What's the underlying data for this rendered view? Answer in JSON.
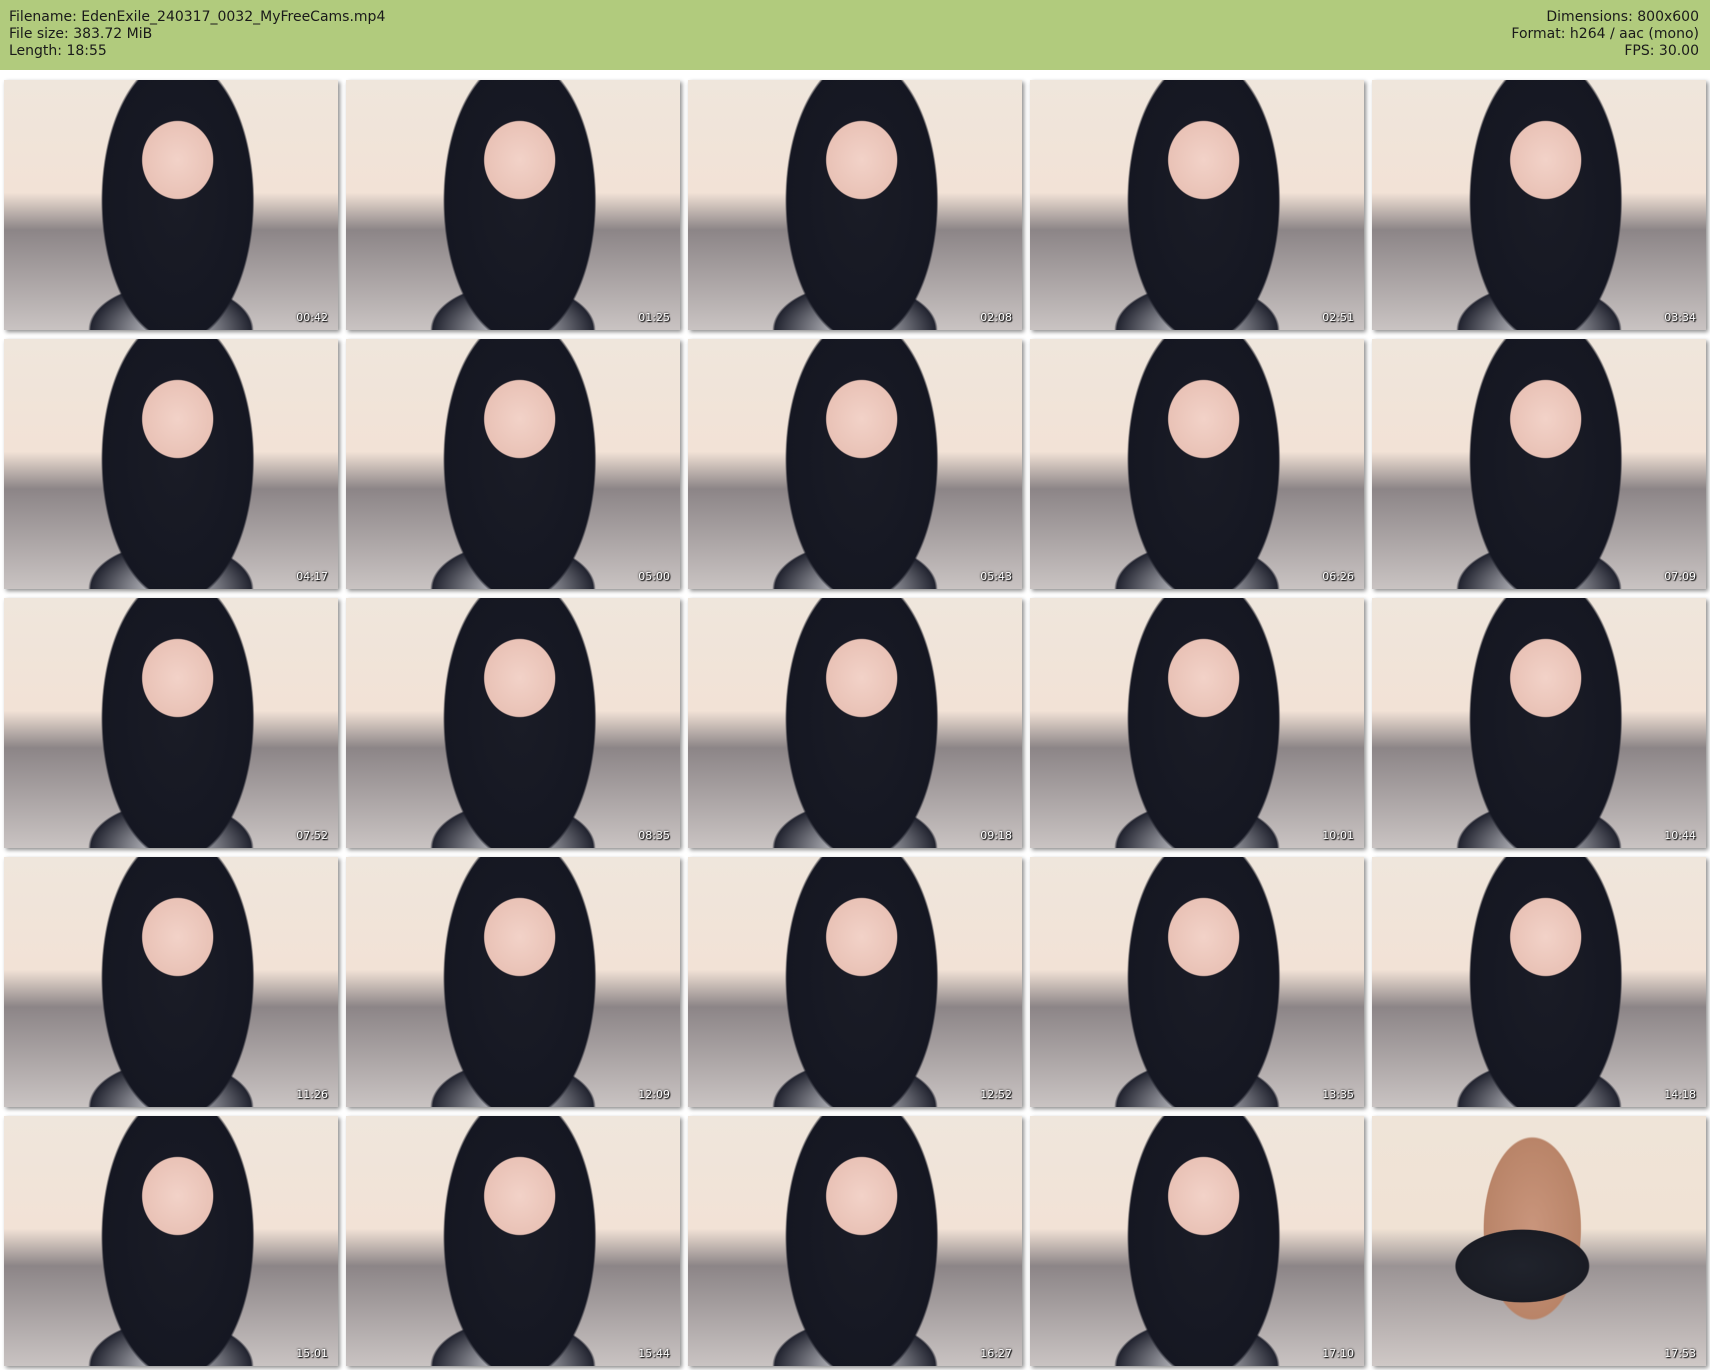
{
  "header": {
    "filename": "Filename: EdenExile_240317_0032_MyFreeCams.mp4",
    "file_size": "File size: 383.72 MiB",
    "length": "Length: 18:55",
    "dimensions": "Dimensions: 800x600",
    "format": "Format: h264 / aac (mono)",
    "fps": "FPS: 30.00"
  },
  "thumbnails": [
    "00:42",
    "01:25",
    "02:08",
    "02:51",
    "03:34",
    "04:17",
    "05:00",
    "05:43",
    "06:26",
    "07:09",
    "07:52",
    "08:35",
    "09:18",
    "10:01",
    "10:44",
    "11:26",
    "12:09",
    "12:52",
    "13:35",
    "14:18",
    "15:01",
    "15:44",
    "16:27",
    "17:10",
    "17:53"
  ]
}
